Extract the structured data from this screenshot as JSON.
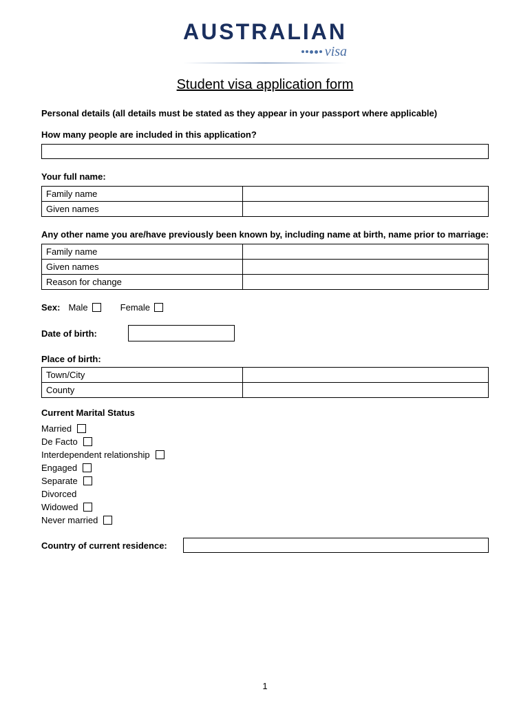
{
  "logo": {
    "australian": "AUSTRALIAN",
    "visa": "visa"
  },
  "form": {
    "title": "Student visa application form"
  },
  "personal_details": {
    "section_label": "Personal details (all details must be stated as they appear in your passport where applicable)",
    "how_many_question": "How many people are included in this application?",
    "your_full_name_label": "Your full name:",
    "name_fields": [
      {
        "label": "Family name",
        "value": ""
      },
      {
        "label": "Given names",
        "value": ""
      }
    ],
    "other_name_label": "Any other name you are/have previously been known by, including name at birth, name prior to marriage:",
    "other_name_fields": [
      {
        "label": "Family name",
        "value": ""
      },
      {
        "label": "Given names",
        "value": ""
      },
      {
        "label": "Reason for change",
        "value": ""
      }
    ],
    "sex_label": "Sex:",
    "male_label": "Male",
    "female_label": "Female",
    "dob_label": "Date of birth:",
    "place_of_birth_label": "Place of birth:",
    "place_fields": [
      {
        "label": "Town/City",
        "value": ""
      },
      {
        "label": "County",
        "value": ""
      }
    ],
    "marital_status_label": "Current Marital Status",
    "marital_options": [
      {
        "label": "Married",
        "has_checkbox": true
      },
      {
        "label": "De Facto",
        "has_checkbox": true
      },
      {
        "label": "Interdependent relationship",
        "has_checkbox": true
      },
      {
        "label": "Engaged",
        "has_checkbox": true
      },
      {
        "label": "Separate",
        "has_checkbox": true
      },
      {
        "label": "Divorced",
        "has_checkbox": false
      },
      {
        "label": "Widowed",
        "has_checkbox": true
      },
      {
        "label": "Never married",
        "has_checkbox": true
      }
    ],
    "country_label": "Country of current residence:"
  },
  "page_number": "1"
}
